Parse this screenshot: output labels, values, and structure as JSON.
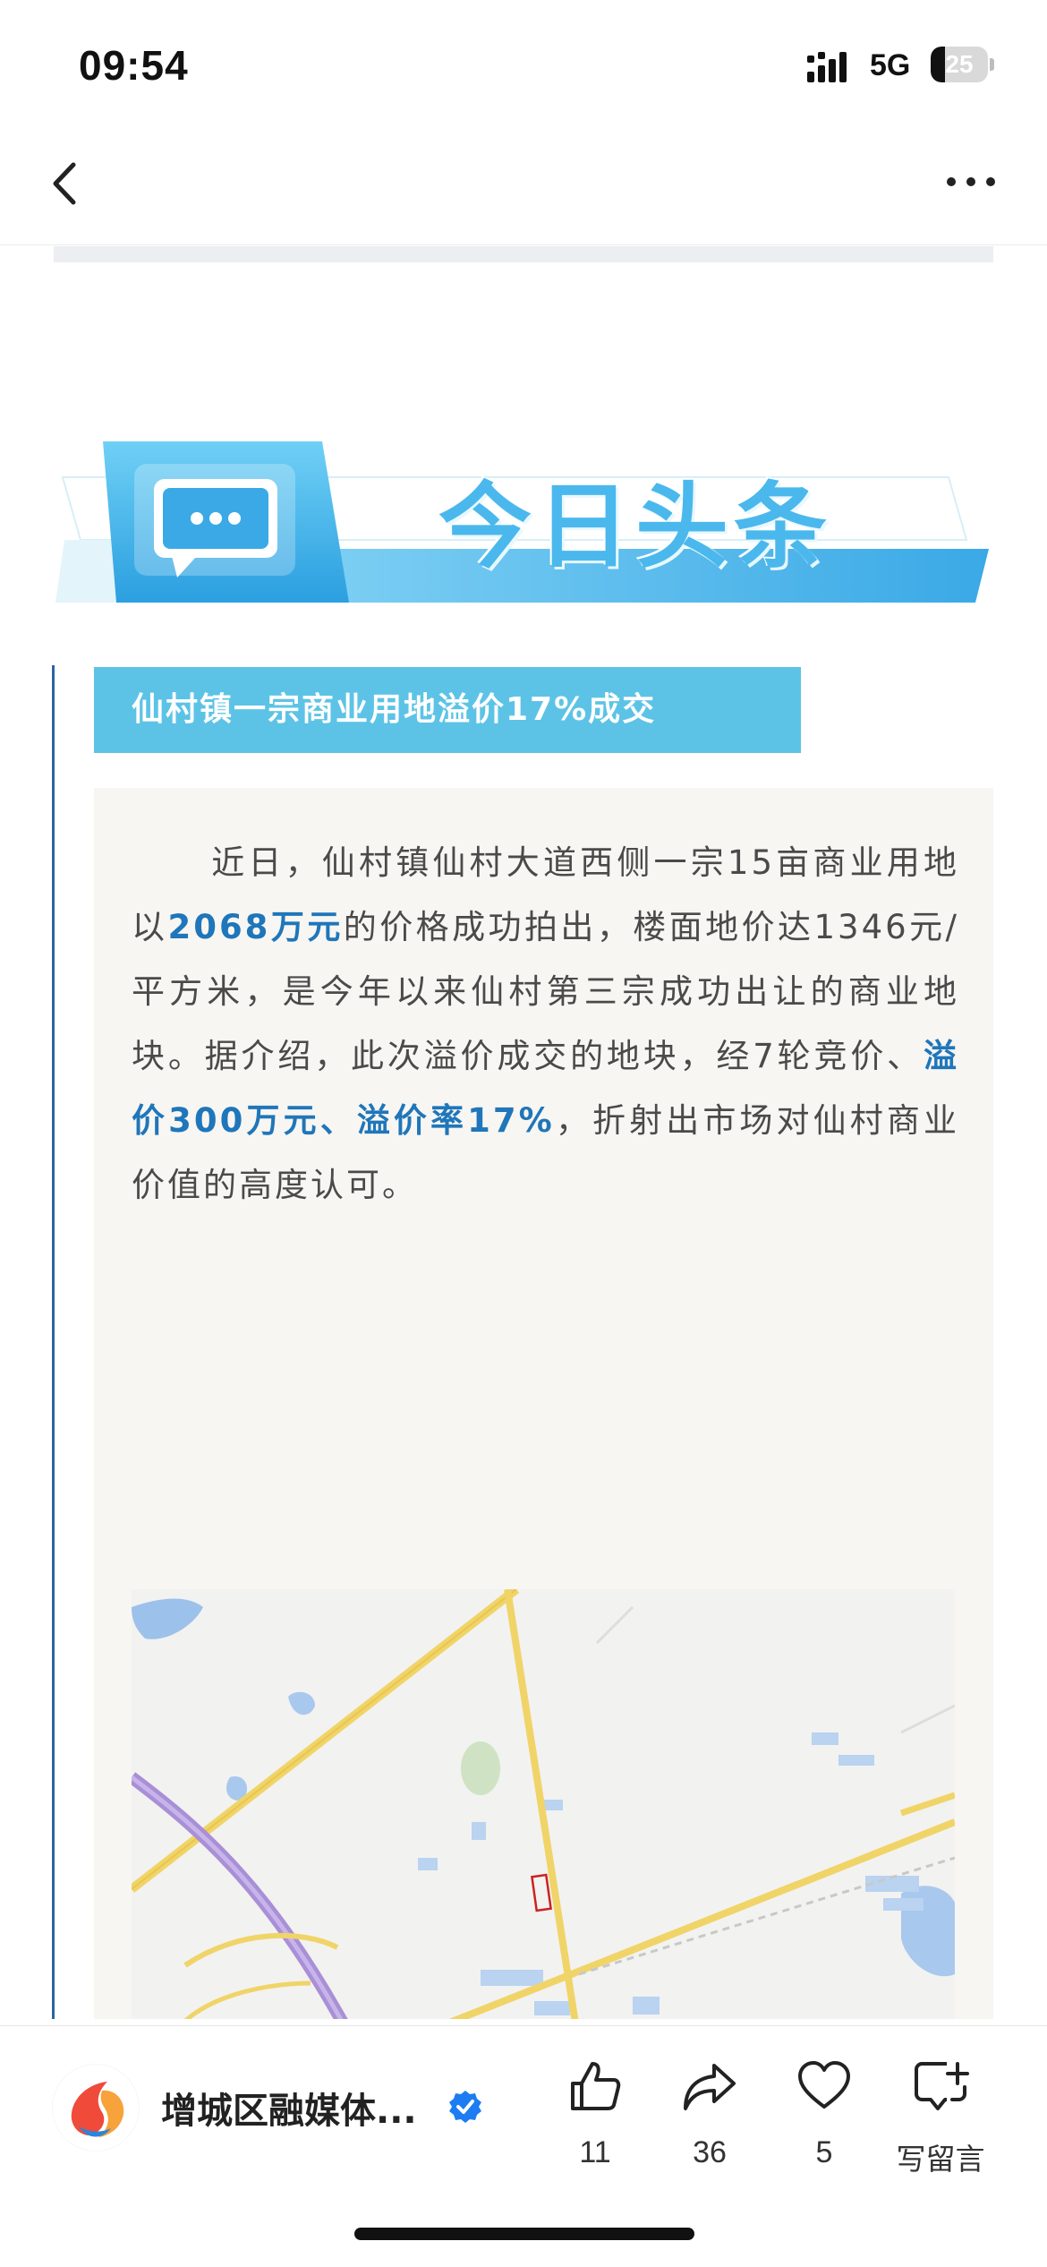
{
  "status_bar": {
    "time": "09:54",
    "network": "5G",
    "battery_level": "25",
    "battery_fraction": 0.25
  },
  "nav": {
    "back_icon": "chevron-left-icon",
    "more_icon": "more-horizontal-icon"
  },
  "article": {
    "banner_title": "今日头条",
    "banner_icon": "chat-bubble-icon",
    "headline": "仙村镇一宗商业用地溢价17%成交",
    "paragraph": {
      "p1": "近日，仙村镇仙村大道西侧一宗15亩商业用地以",
      "em1": "2068万元",
      "p2": "的价格成功拍出，楼面地价达1346元/平方米，是今年以来仙村第三宗成功出让的商业地块。据介绍，此次溢价成交的地块，经7轮竞价、",
      "em2": "溢价300万元、溢价率17%",
      "p3": "，折射出市场对仙村商业价值的高度认可。"
    }
  },
  "action_bar": {
    "account_name": "增城区融媒体...",
    "verified_icon": "verified-badge-icon",
    "like": {
      "icon": "thumbs-up-icon",
      "count": "11"
    },
    "share": {
      "icon": "share-arrow-icon",
      "count": "36"
    },
    "favorite": {
      "icon": "heart-icon",
      "count": "5"
    },
    "comment": {
      "icon": "comment-add-icon",
      "label": "写留言"
    }
  },
  "colors": {
    "accent_blue": "#1f76ba",
    "headline_bg": "#5dc3e6",
    "banner_blue": "#4ab8ec",
    "panel_bg": "#f8f6f2",
    "verified_blue": "#1d7cf2"
  }
}
